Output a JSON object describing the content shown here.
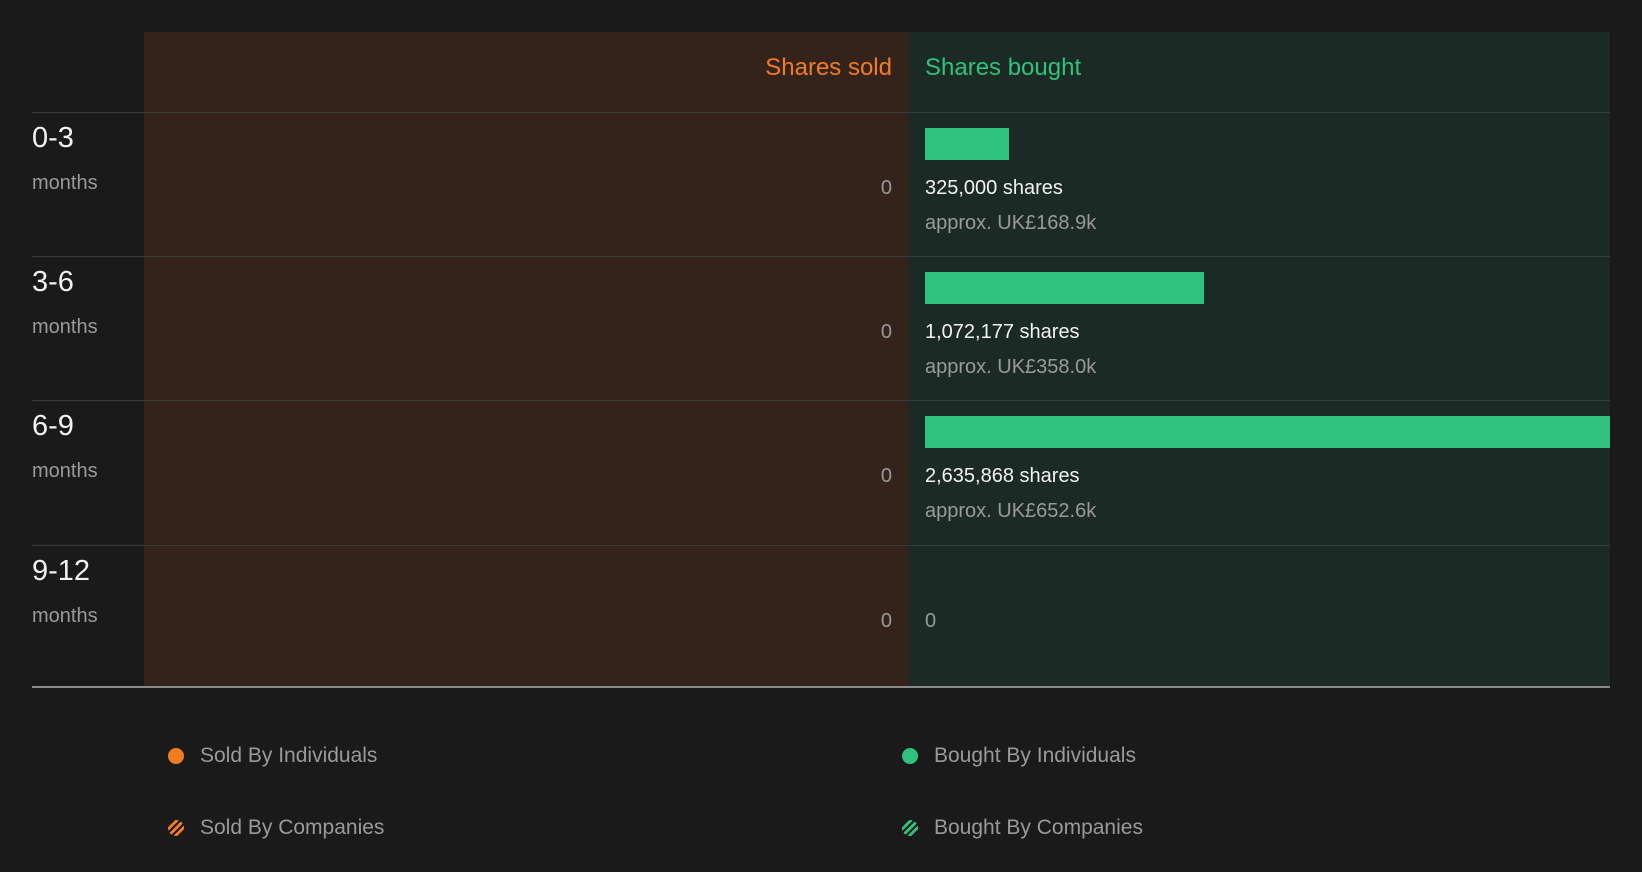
{
  "chart_data": {
    "type": "bar",
    "headers": {
      "sold": "Shares sold",
      "bought": "Shares bought"
    },
    "categories": [
      {
        "period": "0-3",
        "unit": "months"
      },
      {
        "period": "3-6",
        "unit": "months"
      },
      {
        "period": "6-9",
        "unit": "months"
      },
      {
        "period": "9-12",
        "unit": "months"
      }
    ],
    "sold": [
      {
        "label": "0"
      },
      {
        "label": "0"
      },
      {
        "label": "0"
      },
      {
        "label": "0"
      }
    ],
    "bought": [
      {
        "value": 325000,
        "shares_label": "325,000 shares",
        "approx_label": "approx. UK£168.9k",
        "zero_label": ""
      },
      {
        "value": 1072177,
        "shares_label": "1,072,177 shares",
        "approx_label": "approx. UK£358.0k",
        "zero_label": ""
      },
      {
        "value": 2635868,
        "shares_label": "2,635,868 shares",
        "approx_label": "approx. UK£652.6k",
        "zero_label": ""
      },
      {
        "value": 0,
        "shares_label": "",
        "approx_label": "",
        "zero_label": "0"
      }
    ],
    "legend": [
      {
        "label": "Sold By Individuals",
        "icon": "circle",
        "color": "#f47c20"
      },
      {
        "label": "Bought By Individuals",
        "icon": "circle",
        "color": "#2ec27e"
      },
      {
        "label": "Sold By Companies",
        "icon": "hatched-circle",
        "color": "#f47c20"
      },
      {
        "label": "Bought By Companies",
        "icon": "hatched-circle",
        "color": "#2ec27e"
      }
    ],
    "colors": {
      "sold": "#f47c20",
      "bought": "#2ec27e",
      "sold_panel": "#33231b",
      "bought_panel": "#1b2a24",
      "background": "#1a1a1a"
    }
  }
}
